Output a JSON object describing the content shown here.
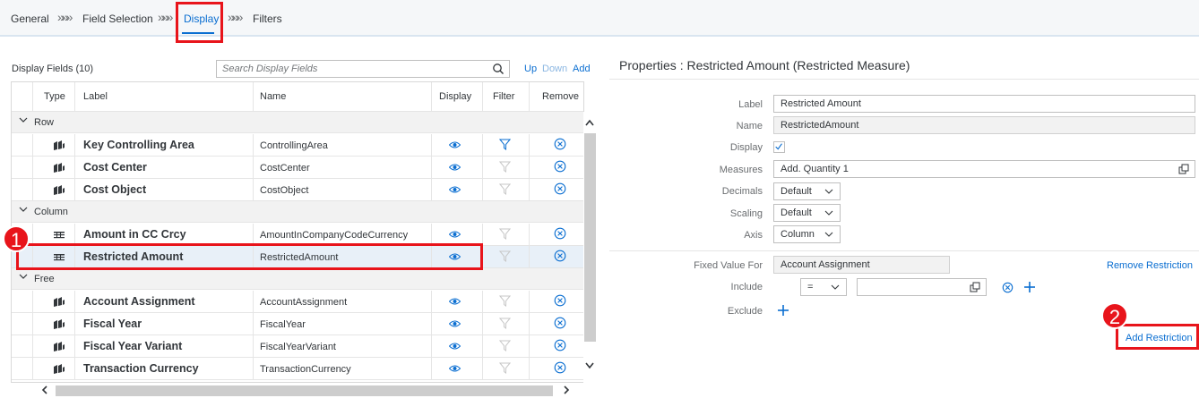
{
  "wizard": {
    "steps": [
      "General",
      "Field Selection",
      "Display",
      "Filters"
    ],
    "separator": "»»»",
    "active_step": "Display"
  },
  "display_fields": {
    "title": "Display Fields (10)",
    "search_placeholder": "Search Display Fields",
    "actions": {
      "up": "Up",
      "down": "Down",
      "add": "Add"
    },
    "columns": [
      "Type",
      "Label",
      "Name",
      "Display",
      "Filter",
      "Remove"
    ],
    "groups": [
      {
        "label": "Row",
        "rows": [
          {
            "type_icon": "dimension-icon",
            "label": "Key Controlling Area",
            "name": "ControllingArea",
            "filter_active": true
          },
          {
            "type_icon": "dimension-icon",
            "label": "Cost Center",
            "name": "CostCenter",
            "filter_active": false
          },
          {
            "type_icon": "dimension-icon",
            "label": "Cost Object",
            "name": "CostObject",
            "filter_active": false
          }
        ]
      },
      {
        "label": "Column",
        "rows": [
          {
            "type_icon": "measure-icon",
            "label": "Amount in CC Crcy",
            "name": "AmountInCompanyCodeCurrency",
            "filter_active": false
          },
          {
            "type_icon": "measure-icon",
            "label": "Restricted Amount",
            "name": "RestrictedAmount",
            "filter_active": false,
            "selected": true
          }
        ]
      },
      {
        "label": "Free",
        "rows": [
          {
            "type_icon": "dimension-icon",
            "label": "Account Assignment",
            "name": "AccountAssignment",
            "filter_active": false
          },
          {
            "type_icon": "dimension-icon",
            "label": "Fiscal Year",
            "name": "FiscalYear",
            "filter_active": false
          },
          {
            "type_icon": "dimension-icon",
            "label": "Fiscal Year Variant",
            "name": "FiscalYearVariant",
            "filter_active": false
          },
          {
            "type_icon": "dimension-icon",
            "label": "Transaction Currency",
            "name": "TransactionCurrency",
            "filter_active": false
          }
        ]
      }
    ]
  },
  "properties": {
    "title": "Properties : Restricted Amount (Restricted Measure)",
    "label_label": "Label",
    "label_value": "Restricted Amount",
    "name_label": "Name",
    "name_value": "RestrictedAmount",
    "display_label": "Display",
    "display_checked": true,
    "measures_label": "Measures",
    "measures_value": "Add. Quantity 1",
    "decimals_label": "Decimals",
    "decimals_value": "Default",
    "scaling_label": "Scaling",
    "scaling_value": "Default",
    "axis_label": "Axis",
    "axis_value": "Column",
    "fixed_value_label": "Fixed Value For",
    "fixed_value": "Account Assignment",
    "remove_restriction": "Remove Restriction",
    "include_label": "Include",
    "include_operator": "=",
    "include_value": "",
    "exclude_label": "Exclude",
    "add_restriction": "Add Restriction"
  },
  "callouts": {
    "one": "1",
    "two": "2"
  },
  "colors": {
    "accent": "#0a6ed1",
    "callout": "#e8141b",
    "selected_row": "#e8f0f8"
  }
}
